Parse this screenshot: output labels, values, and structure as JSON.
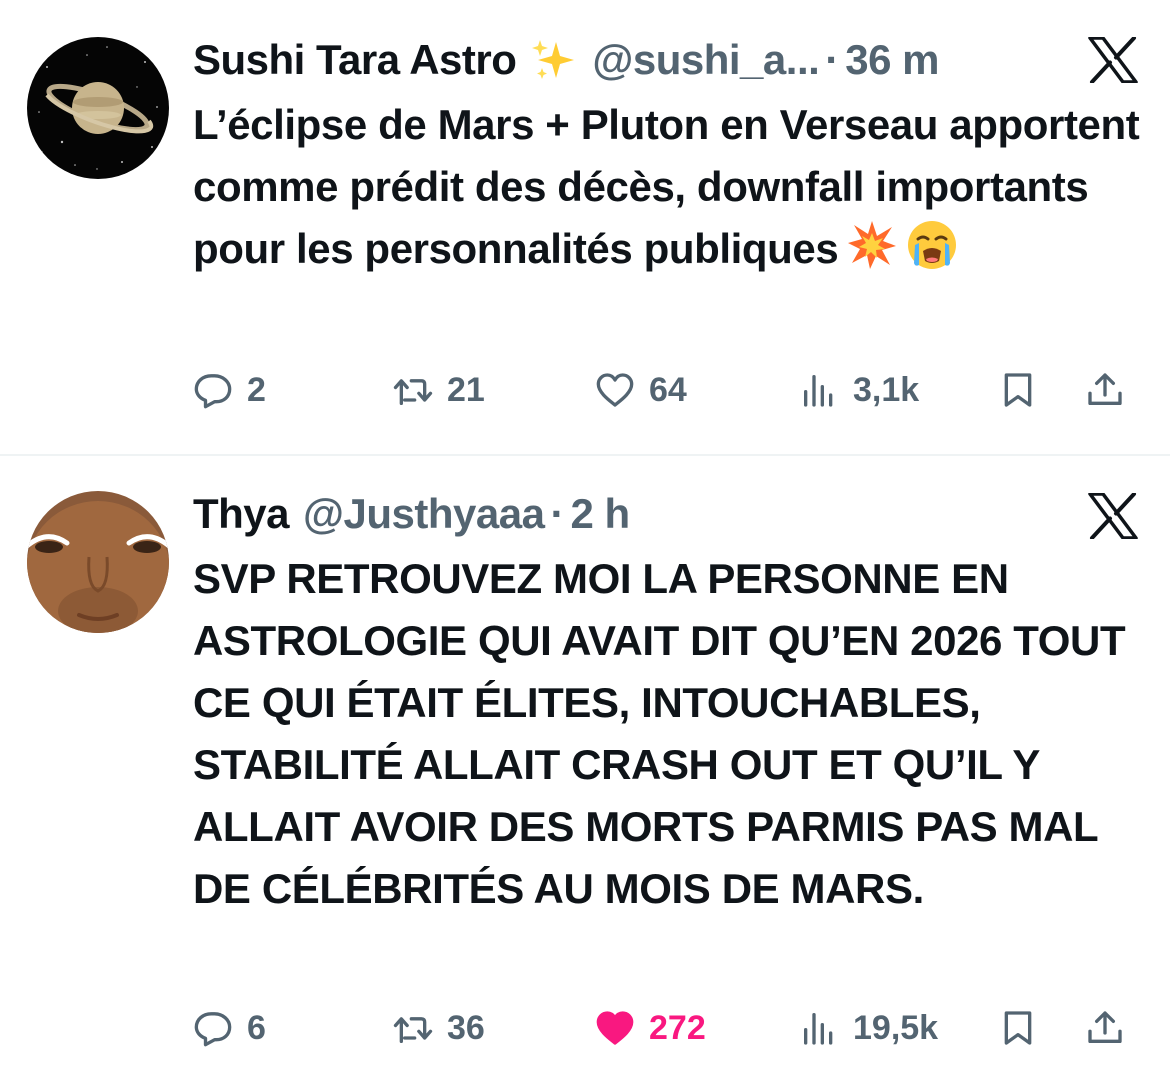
{
  "tweets": [
    {
      "name": "Sushi Tara Astro",
      "handle": "@sushi_a...",
      "dot": "·",
      "time": "36 m",
      "text": "L’éclipse de Mars + Pluton en Verseau apportent comme prédit des décès, downfall importants pour les personnalités publiques",
      "stats": {
        "replies": "2",
        "reposts": "21",
        "likes": "64",
        "views": "3,1k"
      },
      "liked": false
    },
    {
      "name": "Thya",
      "handle": "@Justhyaaa",
      "dot": "·",
      "time": "2 h",
      "text": "SVP RETROUVEZ MOI LA PERSONNE EN ASTROLOGIE QUI AVAIT DIT QU’EN 2026 TOUT CE QUI ÉTAIT ÉLITES, INTOUCHABLES, STABILITÉ ALLAIT CRASH OUT ET QU’IL Y ALLAIT AVOIR DES MORTS PARMIS PAS MAL DE CÉLÉBRITÉS AU MOIS DE MARS.",
      "stats": {
        "replies": "6",
        "reposts": "36",
        "likes": "272",
        "views": "19,5k"
      },
      "liked": true
    }
  ],
  "icons": {
    "platform_logo": "x-logo-icon",
    "reply": "reply-icon",
    "repost": "repost-icon",
    "like": "heart-icon",
    "views": "views-icon",
    "bookmark": "bookmark-icon",
    "share": "share-icon",
    "name_emoji": "sparkles-icon",
    "text_emojis": [
      "collision-icon",
      "loudly-crying-face-icon"
    ]
  },
  "colors": {
    "text": "#0f1419",
    "secondary": "#536471",
    "like_active": "#f91880",
    "divider": "#eff3f4"
  }
}
